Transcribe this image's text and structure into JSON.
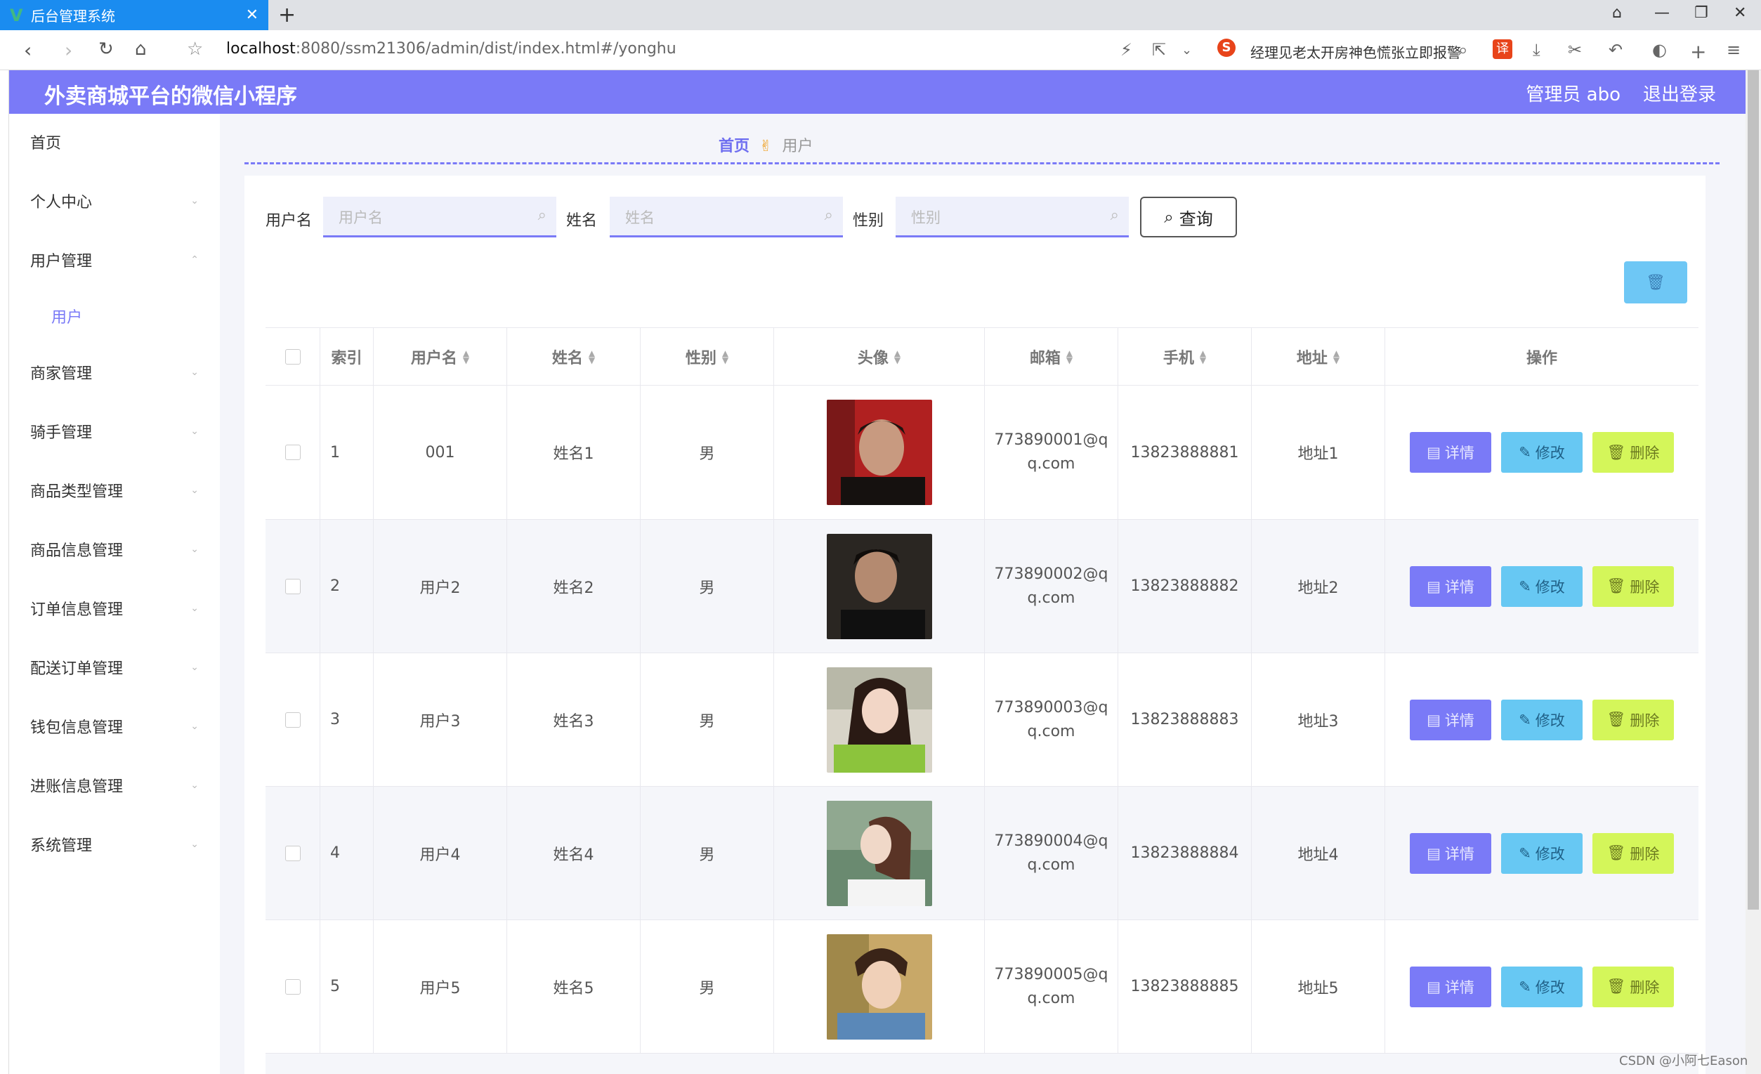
{
  "browser": {
    "tab_logo": "V",
    "tab_title": "后台管理系统",
    "tab_close": "✕",
    "new_tab": "+",
    "url_host": "localhost",
    "url_path": ":8080/ssm21306/admin/dist/index.html#/yonghu",
    "search_text": "经理见老太开房神色慌张立即报警",
    "translate_label": "译",
    "window_controls": [
      "minimize",
      "restore",
      "close"
    ]
  },
  "header": {
    "title": "外卖商城平台的微信小程序",
    "admin": "管理员 abo",
    "logout": "退出登录"
  },
  "sidebar": {
    "items": [
      {
        "label": "首页",
        "expandable": false
      },
      {
        "label": "个人中心",
        "expandable": true,
        "expanded": false
      },
      {
        "label": "用户管理",
        "expandable": true,
        "expanded": true
      },
      {
        "label": "用户",
        "sub": true
      },
      {
        "label": "商家管理",
        "expandable": true,
        "expanded": false
      },
      {
        "label": "骑手管理",
        "expandable": true,
        "expanded": false
      },
      {
        "label": "商品类型管理",
        "expandable": true,
        "expanded": false
      },
      {
        "label": "商品信息管理",
        "expandable": true,
        "expanded": false
      },
      {
        "label": "订单信息管理",
        "expandable": true,
        "expanded": false
      },
      {
        "label": "配送订单管理",
        "expandable": true,
        "expanded": false
      },
      {
        "label": "钱包信息管理",
        "expandable": true,
        "expanded": false
      },
      {
        "label": "进账信息管理",
        "expandable": true,
        "expanded": false
      },
      {
        "label": "系统管理",
        "expandable": true,
        "expanded": false
      }
    ]
  },
  "breadcrumb": {
    "home": "首页",
    "separator": "✌",
    "current": "用户"
  },
  "filters": {
    "username_label": "用户名",
    "username_placeholder": "用户名",
    "name_label": "姓名",
    "name_placeholder": "姓名",
    "gender_label": "性别",
    "gender_placeholder": "性别",
    "query_button": "查询"
  },
  "table": {
    "headers": [
      "索引",
      "用户名",
      "姓名",
      "性别",
      "头像",
      "邮箱",
      "手机",
      "地址",
      "操作"
    ],
    "rows": [
      {
        "index": "1",
        "username": "001",
        "name": "姓名1",
        "gender": "男",
        "email_line1": "773890001@q",
        "email_line2": "q.com",
        "phone": "13823888881",
        "address": "地址1"
      },
      {
        "index": "2",
        "username": "用户2",
        "name": "姓名2",
        "gender": "男",
        "email_line1": "773890002@q",
        "email_line2": "q.com",
        "phone": "13823888882",
        "address": "地址2"
      },
      {
        "index": "3",
        "username": "用户3",
        "name": "姓名3",
        "gender": "男",
        "email_line1": "773890003@q",
        "email_line2": "q.com",
        "phone": "13823888883",
        "address": "地址3"
      },
      {
        "index": "4",
        "username": "用户4",
        "name": "姓名4",
        "gender": "男",
        "email_line1": "773890004@q",
        "email_line2": "q.com",
        "phone": "13823888884",
        "address": "地址4"
      },
      {
        "index": "5",
        "username": "用户5",
        "name": "姓名5",
        "gender": "男",
        "email_line1": "773890005@q",
        "email_line2": "q.com",
        "phone": "13823888885",
        "address": "地址5"
      }
    ],
    "actions": {
      "detail": "详情",
      "edit": "修改",
      "delete": "删除"
    }
  },
  "watermark": "CSDN @小阿七Eason",
  "colors": {
    "accent": "#7a7af7",
    "info": "#67c8f3",
    "warn": "#d4f65a"
  }
}
